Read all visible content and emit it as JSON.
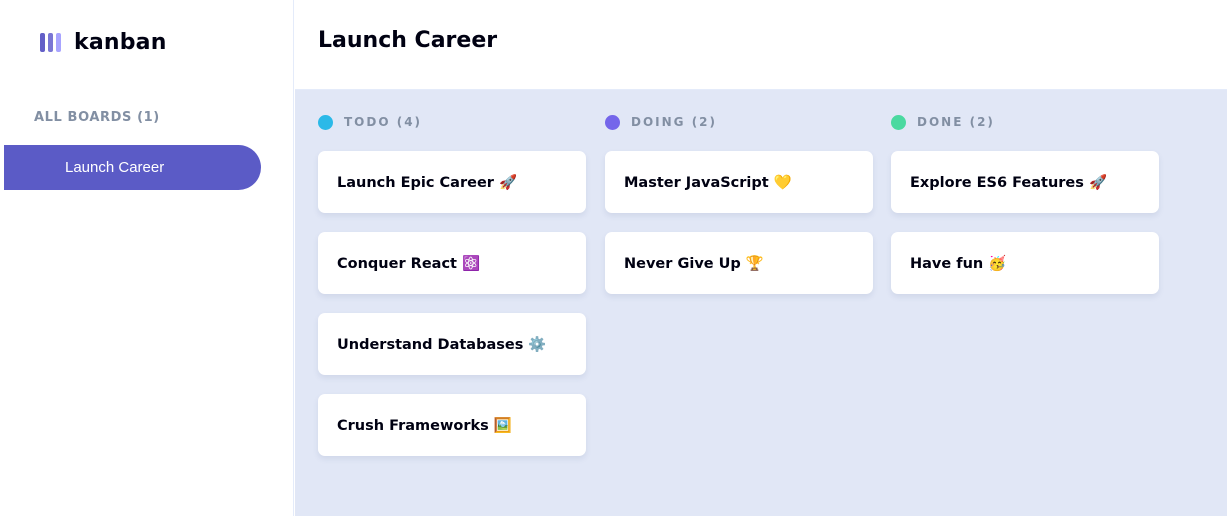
{
  "app": {
    "name": "kanban"
  },
  "colors": {
    "accent": "#5b5bc6",
    "board_bg": "#e1e7f6",
    "logo_bar_1": "#635fc7",
    "logo_bar_2": "#7a76d4",
    "logo_bar_3": "#a8a4ff"
  },
  "sidebar": {
    "heading": "ALL BOARDS (1)",
    "boards": [
      {
        "name": "Launch Career",
        "active": true
      }
    ]
  },
  "header": {
    "title": "Launch Career"
  },
  "columns": [
    {
      "label": "TODO (4)",
      "color": "#2bb9e8",
      "cards": [
        {
          "title": "Launch Epic Career 🚀"
        },
        {
          "title": "Conquer React ⚛️"
        },
        {
          "title": "Understand Databases ⚙️"
        },
        {
          "title": "Crush Frameworks 🖼️"
        }
      ]
    },
    {
      "label": "DOING (2)",
      "color": "#7466ea",
      "cards": [
        {
          "title": "Master JavaScript 💛"
        },
        {
          "title": "Never Give Up 🏆"
        }
      ]
    },
    {
      "label": "DONE (2)",
      "color": "#4ad9a0",
      "cards": [
        {
          "title": "Explore ES6 Features 🚀"
        },
        {
          "title": "Have fun 🥳"
        }
      ]
    }
  ]
}
